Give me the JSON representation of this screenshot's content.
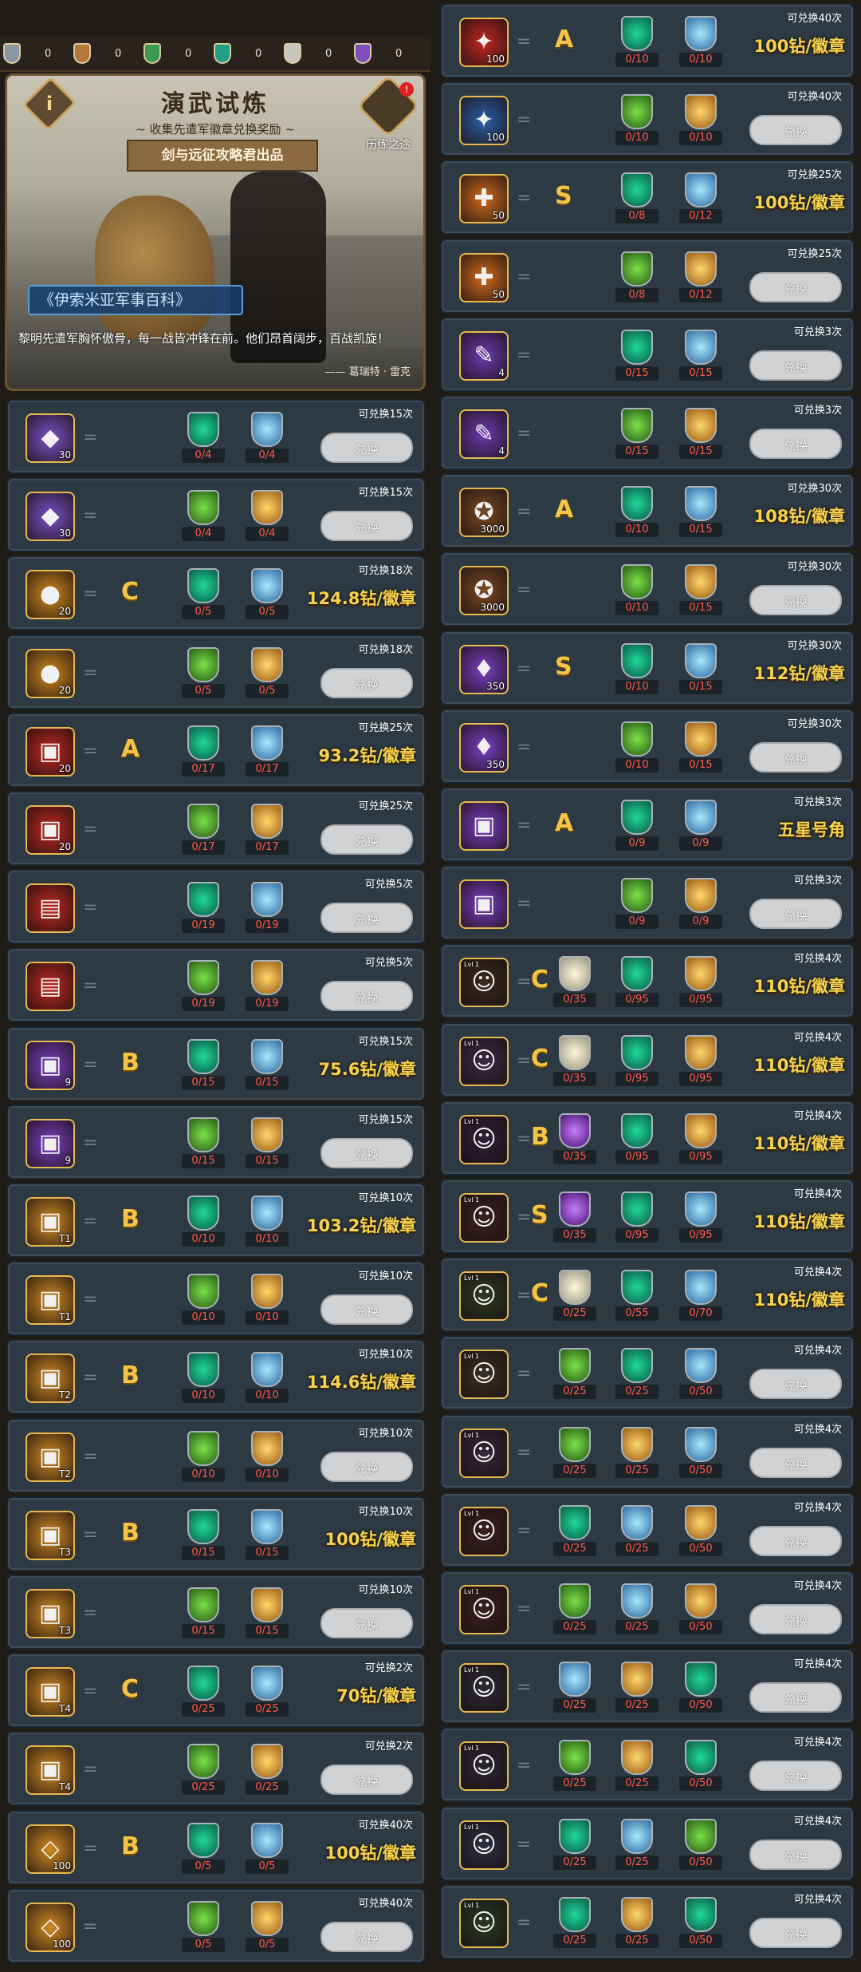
{
  "currency_bar": [
    {
      "icon": "silver-shield-icon",
      "value": "0"
    },
    {
      "icon": "bronze-shield-icon",
      "value": "0"
    },
    {
      "icon": "green-shield-icon",
      "value": "0"
    },
    {
      "icon": "teal-shield-icon",
      "value": "0"
    },
    {
      "icon": "white-shield-icon",
      "value": "0"
    },
    {
      "icon": "purple-shield-icon",
      "value": "0"
    }
  ],
  "banner": {
    "title": "演武试炼",
    "subtitle": "~ 收集先遣军徽章兑换奖励 ~",
    "ribbon": "剑与远征攻略君出品",
    "info_label": "i",
    "road_label": "历练之途",
    "road_badge": "!",
    "book_title": "《伊索米亚军事百科》",
    "quote": "黎明先遣军胸怀傲骨，每一战皆冲锋在前。他们昂首阔步，百战凯旋！",
    "author": "—— 葛瑞特 · 雷克"
  },
  "button_label": "兑换",
  "left_rows": [
    {
      "item": "silver-stone",
      "color": "#7a52c9",
      "glyph": "◆",
      "qty": "30",
      "grade": "",
      "reqs": [
        [
          "b-green",
          "0/4"
        ],
        [
          "b-blue",
          "0/4"
        ]
      ],
      "limit": "可兑换15次",
      "price": ""
    },
    {
      "item": "silver-stone",
      "color": "#7a52c9",
      "glyph": "◆",
      "qty": "30",
      "grade": "",
      "reqs": [
        [
          "b-ogreen",
          "0/4"
        ],
        [
          "b-gold",
          "0/4"
        ]
      ],
      "limit": "可兑换15次",
      "price": ""
    },
    {
      "item": "gold-coin",
      "color": "#d08a1c",
      "glyph": "●",
      "qty": "20",
      "grade": "C",
      "reqs": [
        [
          "b-green",
          "0/5"
        ],
        [
          "b-blue",
          "0/5"
        ]
      ],
      "limit": "可兑换18次",
      "price": "124.8钻/徽章"
    },
    {
      "item": "gold-coin",
      "color": "#d08a1c",
      "glyph": "●",
      "qty": "20",
      "grade": "",
      "reqs": [
        [
          "b-ogreen",
          "0/5"
        ],
        [
          "b-gold",
          "0/5"
        ]
      ],
      "limit": "可兑换18次",
      "price": ""
    },
    {
      "item": "red-chest",
      "color": "#c2271f",
      "glyph": "▣",
      "qty": "20",
      "grade": "A",
      "reqs": [
        [
          "b-green",
          "0/17"
        ],
        [
          "b-blue",
          "0/17"
        ]
      ],
      "limit": "可兑换25次",
      "price": "93.2钻/徽章"
    },
    {
      "item": "red-chest",
      "color": "#c2271f",
      "glyph": "▣",
      "qty": "20",
      "grade": "",
      "reqs": [
        [
          "b-ogreen",
          "0/17"
        ],
        [
          "b-gold",
          "0/17"
        ]
      ],
      "limit": "可兑换25次",
      "price": ""
    },
    {
      "item": "red-chest-open",
      "color": "#c2271f",
      "glyph": "▤",
      "qty": "",
      "grade": "",
      "reqs": [
        [
          "b-green",
          "0/19"
        ],
        [
          "b-blue",
          "0/19"
        ]
      ],
      "limit": "可兑换5次",
      "price": ""
    },
    {
      "item": "red-chest-open",
      "color": "#c2271f",
      "glyph": "▤",
      "qty": "",
      "grade": "",
      "reqs": [
        [
          "b-ogreen",
          "0/19"
        ],
        [
          "b-gold",
          "0/19"
        ]
      ],
      "limit": "可兑换5次",
      "price": ""
    },
    {
      "item": "purple-chest",
      "color": "#7a3fc4",
      "glyph": "▣",
      "qty": "9",
      "grade": "B",
      "reqs": [
        [
          "b-green",
          "0/15"
        ],
        [
          "b-blue",
          "0/15"
        ]
      ],
      "limit": "可兑换15次",
      "price": "75.6钻/徽章"
    },
    {
      "item": "purple-chest",
      "color": "#7a3fc4",
      "glyph": "▣",
      "qty": "9",
      "grade": "",
      "reqs": [
        [
          "b-ogreen",
          "0/15"
        ],
        [
          "b-gold",
          "0/15"
        ]
      ],
      "limit": "可兑换15次",
      "price": ""
    },
    {
      "item": "t1-chest",
      "color": "#d18b21",
      "glyph": "▣",
      "qty": "T1",
      "grade": "B",
      "reqs": [
        [
          "b-green",
          "0/10"
        ],
        [
          "b-blue",
          "0/10"
        ]
      ],
      "limit": "可兑换10次",
      "price": "103.2钻/徽章"
    },
    {
      "item": "t1-chest",
      "color": "#d18b21",
      "glyph": "▣",
      "qty": "T1",
      "grade": "",
      "reqs": [
        [
          "b-ogreen",
          "0/10"
        ],
        [
          "b-gold",
          "0/10"
        ]
      ],
      "limit": "可兑换10次",
      "price": ""
    },
    {
      "item": "t2-chest",
      "color": "#d18b21",
      "glyph": "▣",
      "qty": "T2",
      "grade": "B",
      "reqs": [
        [
          "b-green",
          "0/10"
        ],
        [
          "b-blue",
          "0/10"
        ]
      ],
      "limit": "可兑换10次",
      "price": "114.6钻/徽章"
    },
    {
      "item": "t2-chest",
      "color": "#d18b21",
      "glyph": "▣",
      "qty": "T2",
      "grade": "",
      "reqs": [
        [
          "b-ogreen",
          "0/10"
        ],
        [
          "b-gold",
          "0/10"
        ]
      ],
      "limit": "可兑换10次",
      "price": ""
    },
    {
      "item": "t3-chest",
      "color": "#d18b21",
      "glyph": "▣",
      "qty": "T3",
      "grade": "B",
      "reqs": [
        [
          "b-green",
          "0/15"
        ],
        [
          "b-blue",
          "0/15"
        ]
      ],
      "limit": "可兑换10次",
      "price": "100钻/徽章"
    },
    {
      "item": "t3-chest",
      "color": "#d18b21",
      "glyph": "▣",
      "qty": "T3",
      "grade": "",
      "reqs": [
        [
          "b-ogreen",
          "0/15"
        ],
        [
          "b-gold",
          "0/15"
        ]
      ],
      "limit": "可兑换10次",
      "price": ""
    },
    {
      "item": "t4-chest",
      "color": "#d18b21",
      "glyph": "▣",
      "qty": "T4",
      "grade": "C",
      "reqs": [
        [
          "b-green",
          "0/25"
        ],
        [
          "b-blue",
          "0/25"
        ]
      ],
      "limit": "可兑换2次",
      "price": "70钻/徽章"
    },
    {
      "item": "t4-chest",
      "color": "#d18b21",
      "glyph": "▣",
      "qty": "T4",
      "grade": "",
      "reqs": [
        [
          "b-ogreen",
          "0/25"
        ],
        [
          "b-gold",
          "0/25"
        ]
      ],
      "limit": "可兑换2次",
      "price": ""
    },
    {
      "item": "blue-crystal",
      "color": "#d18b21",
      "glyph": "◇",
      "qty": "100",
      "grade": "B",
      "reqs": [
        [
          "b-green",
          "0/5"
        ],
        [
          "b-blue",
          "0/5"
        ]
      ],
      "limit": "可兑换40次",
      "price": "100钻/徽章"
    },
    {
      "item": "blue-crystal",
      "color": "#d18b21",
      "glyph": "◇",
      "qty": "100",
      "grade": "",
      "reqs": [
        [
          "b-ogreen",
          "0/5"
        ],
        [
          "b-gold",
          "0/5"
        ]
      ],
      "limit": "可兑换40次",
      "price": ""
    }
  ],
  "right_rows": [
    {
      "item": "pink-scroll",
      "color": "#c2271f",
      "glyph": "✦",
      "qty": "100",
      "grade": "A",
      "reqs": [
        [
          "b-green",
          "0/10"
        ],
        [
          "b-blue",
          "0/10"
        ]
      ],
      "limit": "可兑换40次",
      "price": "100钻/徽章"
    },
    {
      "item": "pink-scroll",
      "color": "#2a5fa8",
      "glyph": "✦",
      "qty": "100",
      "grade": "",
      "reqs": [
        [
          "b-ogreen",
          "0/10"
        ],
        [
          "b-gold",
          "0/10"
        ]
      ],
      "limit": "可兑换40次",
      "price": ""
    },
    {
      "item": "emblem-orange",
      "color": "#d06b1c",
      "glyph": "✚",
      "qty": "50",
      "grade": "S",
      "reqs": [
        [
          "b-green",
          "0/8"
        ],
        [
          "b-blue",
          "0/12"
        ]
      ],
      "limit": "可兑换25次",
      "price": "100钻/徽章"
    },
    {
      "item": "emblem-orange",
      "color": "#d06b1c",
      "glyph": "✚",
      "qty": "50",
      "grade": "",
      "reqs": [
        [
          "b-ogreen",
          "0/8"
        ],
        [
          "b-gold",
          "0/12"
        ]
      ],
      "limit": "可兑换25次",
      "price": ""
    },
    {
      "item": "purple-scroll",
      "color": "#6a3bb0",
      "glyph": "✎",
      "qty": "4",
      "grade": "",
      "reqs": [
        [
          "b-green",
          "0/15"
        ],
        [
          "b-blue",
          "0/15"
        ]
      ],
      "limit": "可兑换3次",
      "price": ""
    },
    {
      "item": "purple-scroll",
      "color": "#6a3bb0",
      "glyph": "✎",
      "qty": "4",
      "grade": "",
      "reqs": [
        [
          "b-ogreen",
          "0/15"
        ],
        [
          "b-gold",
          "0/15"
        ]
      ],
      "limit": "可兑换3次",
      "price": ""
    },
    {
      "item": "compass",
      "color": "#7a4a22",
      "glyph": "✪",
      "qty": "3000",
      "grade": "A",
      "reqs": [
        [
          "b-green",
          "0/10"
        ],
        [
          "b-blue",
          "0/15"
        ]
      ],
      "limit": "可兑换30次",
      "price": "108钻/徽章"
    },
    {
      "item": "compass",
      "color": "#7a4a22",
      "glyph": "✪",
      "qty": "3000",
      "grade": "",
      "reqs": [
        [
          "b-ogreen",
          "0/10"
        ],
        [
          "b-gold",
          "0/15"
        ]
      ],
      "limit": "可兑换30次",
      "price": ""
    },
    {
      "item": "gold-bottle",
      "color": "#7a3fc4",
      "glyph": "♦",
      "qty": "350",
      "grade": "S",
      "reqs": [
        [
          "b-green",
          "0/10"
        ],
        [
          "b-blue",
          "0/15"
        ]
      ],
      "limit": "可兑换30次",
      "price": "112钻/徽章"
    },
    {
      "item": "gold-bottle",
      "color": "#7a3fc4",
      "glyph": "♦",
      "qty": "350",
      "grade": "",
      "reqs": [
        [
          "b-ogreen",
          "0/10"
        ],
        [
          "b-gold",
          "0/15"
        ]
      ],
      "limit": "可兑换30次",
      "price": ""
    },
    {
      "item": "purple-star-chest",
      "color": "#7a3fc4",
      "glyph": "▣",
      "qty": "",
      "grade": "A",
      "reqs": [
        [
          "b-green",
          "0/9"
        ],
        [
          "b-blue",
          "0/9"
        ]
      ],
      "limit": "可兑换3次",
      "price": "五星号角"
    },
    {
      "item": "purple-star-chest",
      "color": "#7a3fc4",
      "glyph": "▣",
      "qty": "",
      "grade": "",
      "reqs": [
        [
          "b-ogreen",
          "0/9"
        ],
        [
          "b-gold",
          "0/9"
        ]
      ],
      "limit": "可兑换3次",
      "price": ""
    },
    {
      "item": "hero-portrait",
      "color": "#3a2a1c",
      "glyph": "☺",
      "qty": "",
      "grade": "C",
      "reqs": [
        [
          "b-white",
          "0/35"
        ],
        [
          "b-green",
          "0/95"
        ],
        [
          "b-gold",
          "0/95"
        ]
      ],
      "limit": "可兑换4次",
      "price": "110钻/徽章"
    },
    {
      "item": "hero-portrait",
      "color": "#3a2a44",
      "glyph": "☺",
      "qty": "",
      "grade": "C",
      "reqs": [
        [
          "b-white",
          "0/35"
        ],
        [
          "b-green",
          "0/95"
        ],
        [
          "b-gold",
          "0/95"
        ]
      ],
      "limit": "可兑换4次",
      "price": "110钻/徽章"
    },
    {
      "item": "hero-portrait",
      "color": "#2c1f3a",
      "glyph": "☺",
      "qty": "",
      "grade": "B",
      "reqs": [
        [
          "b-purple",
          "0/35"
        ],
        [
          "b-green",
          "0/95"
        ],
        [
          "b-gold",
          "0/95"
        ]
      ],
      "limit": "可兑换4次",
      "price": "110钻/徽章"
    },
    {
      "item": "hero-portrait",
      "color": "#3a1f22",
      "glyph": "☺",
      "qty": "",
      "grade": "S",
      "reqs": [
        [
          "b-purple",
          "0/35"
        ],
        [
          "b-green",
          "0/95"
        ],
        [
          "b-blue",
          "0/95"
        ]
      ],
      "limit": "可兑换4次",
      "price": "110钻/徽章"
    },
    {
      "item": "hero-portrait",
      "color": "#2d3a22",
      "glyph": "☺",
      "qty": "",
      "grade": "C",
      "reqs": [
        [
          "b-white",
          "0/25"
        ],
        [
          "b-green",
          "0/55"
        ],
        [
          "b-blue",
          "0/70"
        ]
      ],
      "limit": "可兑换4次",
      "price": "110钻/徽章"
    },
    {
      "item": "hero-portrait",
      "color": "#3a2e22",
      "glyph": "☺",
      "qty": "",
      "grade": "",
      "reqs": [
        [
          "b-ogreen",
          "0/25"
        ],
        [
          "b-green",
          "0/25"
        ],
        [
          "b-blue",
          "0/50"
        ]
      ],
      "limit": "可兑换4次",
      "price": ""
    },
    {
      "item": "hero-portrait",
      "color": "#33273a",
      "glyph": "☺",
      "qty": "",
      "grade": "",
      "reqs": [
        [
          "b-ogreen",
          "0/25"
        ],
        [
          "b-gold",
          "0/25"
        ],
        [
          "b-blue",
          "0/50"
        ]
      ],
      "limit": "可兑换4次",
      "price": ""
    },
    {
      "item": "hero-portrait",
      "color": "#3a1f1f",
      "glyph": "☺",
      "qty": "",
      "grade": "",
      "reqs": [
        [
          "b-green",
          "0/25"
        ],
        [
          "b-blue",
          "0/25"
        ],
        [
          "b-gold",
          "0/50"
        ]
      ],
      "limit": "可兑换4次",
      "price": ""
    },
    {
      "item": "hero-portrait",
      "color": "#3a1f1f",
      "glyph": "☺",
      "qty": "",
      "grade": "",
      "reqs": [
        [
          "b-ogreen",
          "0/25"
        ],
        [
          "b-blue",
          "0/25"
        ],
        [
          "b-gold",
          "0/50"
        ]
      ],
      "limit": "可兑换4次",
      "price": ""
    },
    {
      "item": "hero-portrait",
      "color": "#2a2a33",
      "glyph": "☺",
      "qty": "",
      "grade": "",
      "reqs": [
        [
          "b-blue",
          "0/25"
        ],
        [
          "b-gold",
          "0/25"
        ],
        [
          "b-green",
          "0/50"
        ]
      ],
      "limit": "可兑换4次",
      "price": ""
    },
    {
      "item": "hero-portrait",
      "color": "#2a2630",
      "glyph": "☺",
      "qty": "",
      "grade": "",
      "reqs": [
        [
          "b-ogreen",
          "0/25"
        ],
        [
          "b-gold",
          "0/25"
        ],
        [
          "b-green",
          "0/50"
        ]
      ],
      "limit": "可兑换4次",
      "price": ""
    },
    {
      "item": "hero-portrait",
      "color": "#2a2e44",
      "glyph": "☺",
      "qty": "",
      "grade": "",
      "reqs": [
        [
          "b-green",
          "0/25"
        ],
        [
          "b-blue",
          "0/25"
        ],
        [
          "b-ogreen",
          "0/50"
        ]
      ],
      "limit": "可兑换4次",
      "price": ""
    },
    {
      "item": "hero-portrait",
      "color": "#263a26",
      "glyph": "☺",
      "qty": "",
      "grade": "",
      "reqs": [
        [
          "b-green",
          "0/25"
        ],
        [
          "b-gold",
          "0/25"
        ],
        [
          "b-green",
          "0/50"
        ]
      ],
      "limit": "可兑换4次",
      "price": ""
    }
  ]
}
